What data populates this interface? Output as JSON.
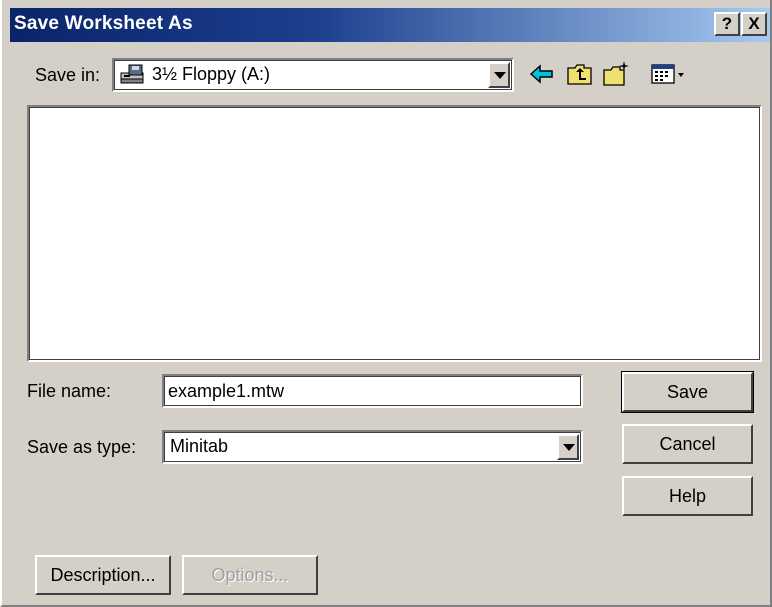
{
  "title": "Save Worksheet As",
  "title_buttons": {
    "help": "?",
    "close": "X"
  },
  "save_in": {
    "label": "Save in:",
    "value": "3½ Floppy (A:)",
    "icon": "floppy-drive-icon"
  },
  "toolbar": {
    "icons": [
      "back-arrow-icon",
      "up-one-level-icon",
      "create-new-folder-icon",
      "view-menu-icon"
    ]
  },
  "file_list": {
    "items": []
  },
  "file_name": {
    "label": "File name:",
    "value": "example1.mtw"
  },
  "save_as_type": {
    "label": "Save as type:",
    "value": "Minitab"
  },
  "buttons": {
    "save": "Save",
    "cancel": "Cancel",
    "help": "Help",
    "description": "Description...",
    "options": "Options..."
  },
  "colors": {
    "title_start": "#0a246a",
    "title_end": "#a6caf0",
    "face": "#d4d0c8"
  }
}
